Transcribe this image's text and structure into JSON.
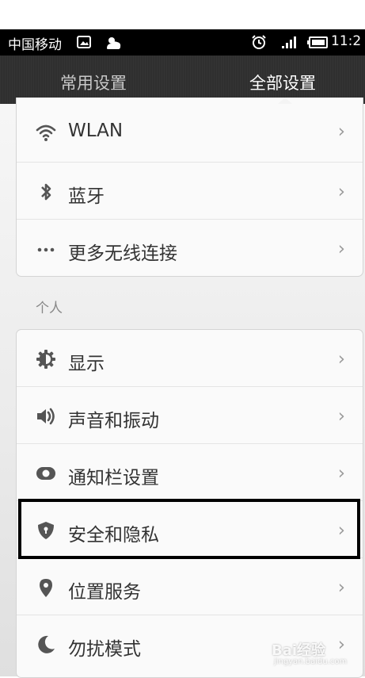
{
  "status_bar": {
    "carrier": "中国移动",
    "time": "11:2",
    "icons": [
      "image-notification-icon",
      "weather-icon",
      "alarm-icon",
      "signal-icon",
      "battery-icon"
    ]
  },
  "tabs": [
    {
      "label": "常用设置",
      "selected": false
    },
    {
      "label": "全部设置",
      "selected": true
    }
  ],
  "wireless": {
    "items": [
      {
        "label": "WLAN",
        "icon": "wifi-icon"
      },
      {
        "label": "蓝牙",
        "icon": "bluetooth-icon"
      },
      {
        "label": "更多无线连接",
        "icon": "more-dots-icon"
      }
    ]
  },
  "personal": {
    "header": "个人",
    "items": [
      {
        "label": "显示",
        "icon": "display-gear-icon"
      },
      {
        "label": "声音和振动",
        "icon": "speaker-icon"
      },
      {
        "label": "通知栏设置",
        "icon": "toggle-icon"
      },
      {
        "label": "安全和隐私",
        "icon": "shield-icon"
      },
      {
        "label": "位置服务",
        "icon": "location-pin-icon"
      },
      {
        "label": "勿扰模式",
        "icon": "moon-icon"
      }
    ]
  },
  "chevron": "›",
  "watermark": {
    "text": "Bai经验",
    "sub": "jingyan.baidu.com"
  },
  "colors": {
    "tab_bar": "#2f2f2f",
    "status_bar": "#000000",
    "icon": "#555555",
    "highlight": "#000000"
  }
}
